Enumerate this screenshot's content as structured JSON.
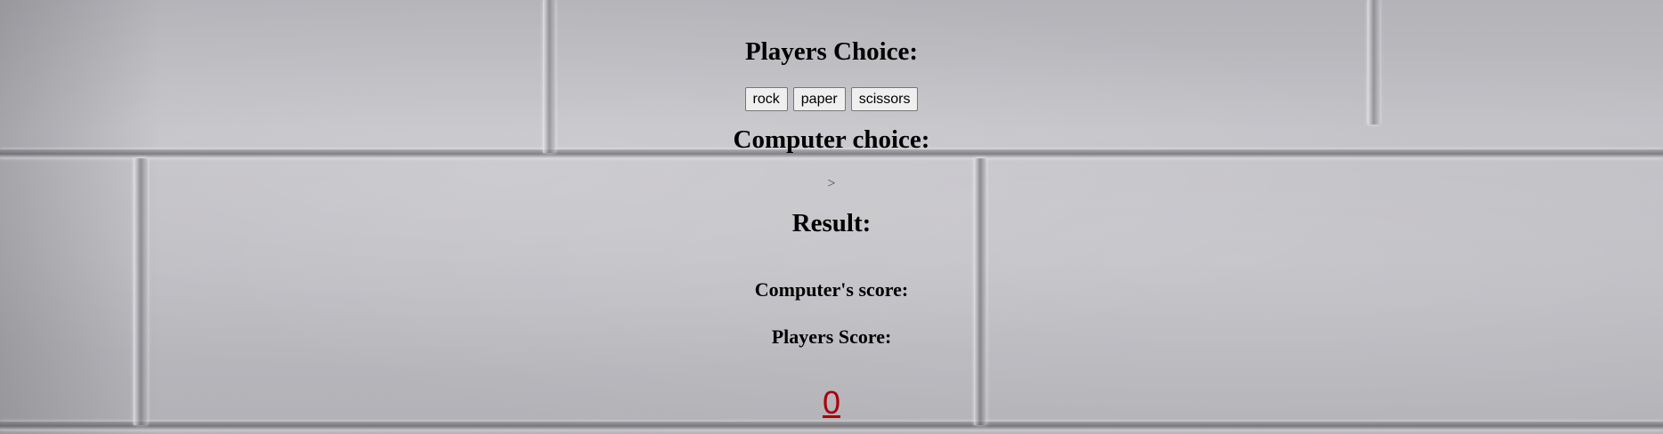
{
  "players_choice": {
    "heading": "Players Choice:",
    "buttons": [
      "rock",
      "paper",
      "scissors"
    ]
  },
  "computer_choice": {
    "heading": "Computer choice:",
    "output": ">"
  },
  "result": {
    "heading": "Result:"
  },
  "scores": {
    "computer_label": "Computer's score:",
    "player_label": "Players Score:"
  },
  "bottom_link": {
    "text": "0"
  },
  "colors": {
    "link": "#a8000a",
    "background": "brick-wall-gray"
  }
}
